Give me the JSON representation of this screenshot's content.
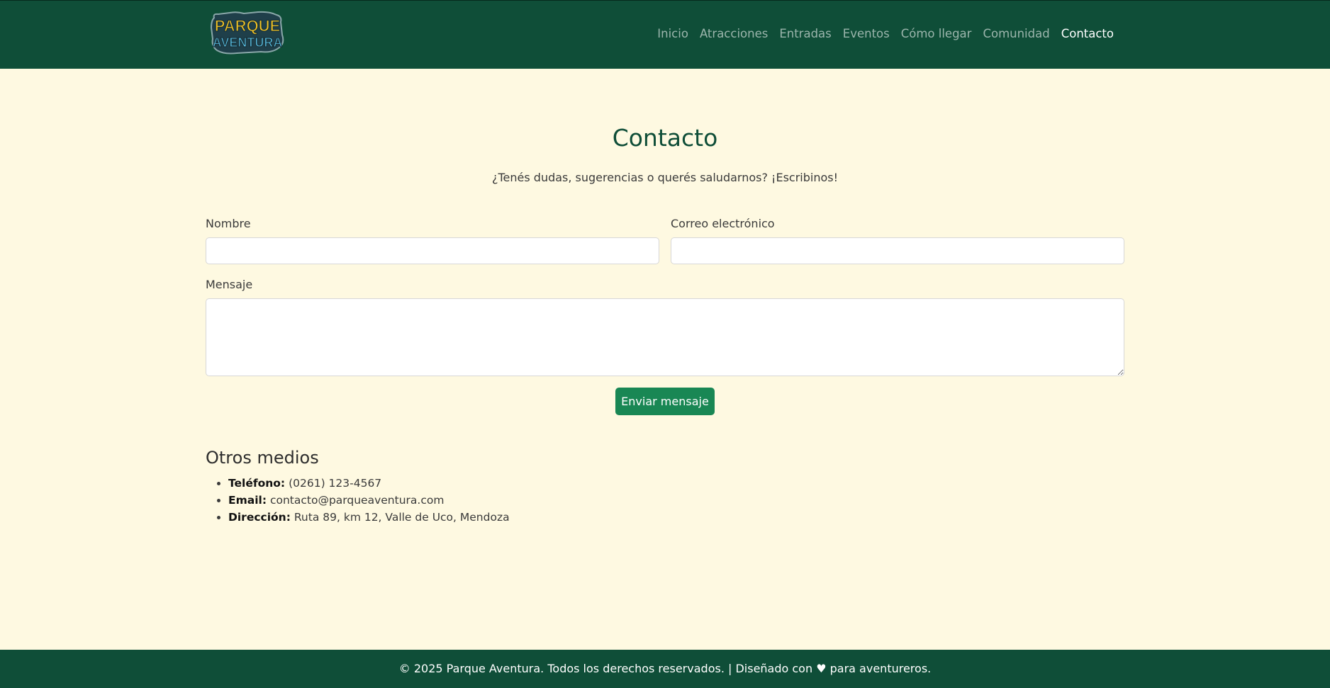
{
  "brand": {
    "logo_line1": "PARQUE",
    "logo_line2": "AVENTURA"
  },
  "nav": {
    "items": [
      {
        "label": "Inicio",
        "active": false
      },
      {
        "label": "Atracciones",
        "active": false
      },
      {
        "label": "Entradas",
        "active": false
      },
      {
        "label": "Eventos",
        "active": false
      },
      {
        "label": "Cómo llegar",
        "active": false
      },
      {
        "label": "Comunidad",
        "active": false
      },
      {
        "label": "Contacto",
        "active": true
      }
    ]
  },
  "main": {
    "title": "Contacto",
    "subtitle": "¿Tenés dudas, sugerencias o querés saludarnos? ¡Escribinos!"
  },
  "form": {
    "name_label": "Nombre",
    "name_value": "",
    "email_label": "Correo electrónico",
    "email_value": "",
    "message_label": "Mensaje",
    "message_value": "",
    "submit_label": "Enviar mensaje"
  },
  "other": {
    "heading": "Otros medios",
    "items": [
      {
        "label": "Teléfono:",
        "value": "(0261) 123-4567"
      },
      {
        "label": "Email:",
        "value": "contacto@parqueaventura.com"
      },
      {
        "label": "Dirección:",
        "value": "Ruta 89, km 12, Valle de Uco, Mendoza"
      }
    ]
  },
  "footer": {
    "text": "© 2025 Parque Aventura. Todos los derechos reservados. | Diseñado con ♥ para aventureros."
  },
  "colors": {
    "header_bg": "#0f4e38",
    "page_bg": "#fef9e1",
    "button_bg": "#198754",
    "logo_yellow": "#f5c423",
    "logo_blue": "#5bc3e8"
  }
}
